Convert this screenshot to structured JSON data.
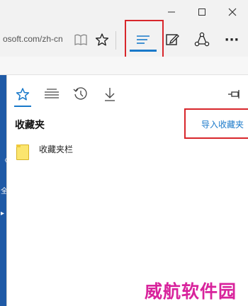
{
  "window": {
    "controls": [
      {
        "name": "minimize-button",
        "icon": "minimize-icon"
      },
      {
        "name": "maximize-button",
        "icon": "maximize-icon"
      },
      {
        "name": "close-button",
        "icon": "close-icon"
      }
    ]
  },
  "toolbar": {
    "url_text": "osoft.com/zh-cn",
    "icons": [
      "reading-view-icon",
      "favorite-star-icon",
      "hub-icon",
      "web-note-icon",
      "share-icon",
      "more-icon"
    ],
    "more_label": "···",
    "active_color": "#1979ca"
  },
  "hub": {
    "tabs": [
      "favorites-tab-icon",
      "reading-list-tab-icon",
      "history-tab-icon",
      "downloads-tab-icon"
    ],
    "pin_icon": "pin-icon",
    "title": "收藏夹",
    "import_label": "导入收藏夹",
    "items": [
      {
        "label": "收藏夹栏",
        "icon": "folder-icon"
      }
    ]
  },
  "annotations": {
    "highlight_color": "#d8262b"
  },
  "watermark": "威航软件园"
}
